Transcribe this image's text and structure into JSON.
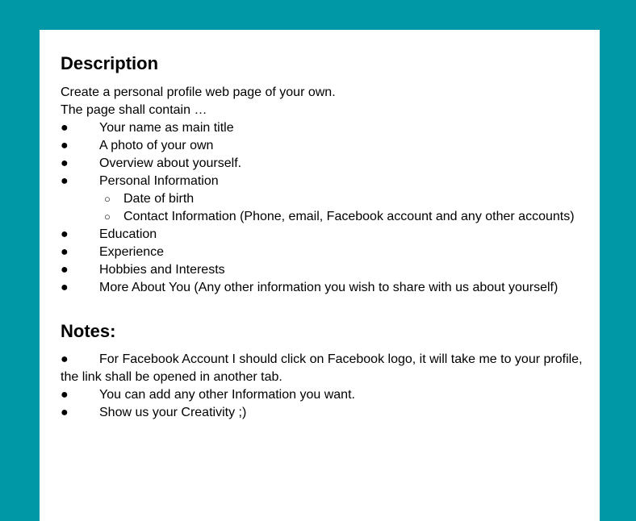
{
  "description": {
    "title": "Description",
    "intro1": "Create a personal profile web page of your own.",
    "intro2": "The page shall contain …",
    "bullet_glyph": "●",
    "sub_bullet_glyph": "○",
    "items": [
      "Your name as main title",
      "A photo of your own",
      "Overview about yourself.",
      "Personal Information"
    ],
    "sub_items": [
      "Date of birth",
      "Contact Information (Phone, email, Facebook account and any other accounts)"
    ],
    "items_after": [
      "Education",
      "Experience",
      "Hobbies and Interests",
      "More About You (Any other  information you wish to share with us about yourself)"
    ]
  },
  "notes": {
    "title": "Notes:",
    "note1_line1": "For Facebook Account I should click on Facebook logo, it will take me to your profile,",
    "note1_line2": "the link shall be opened in another tab.",
    "note2": "You can add any other Information you want.",
    "note3": "Show us your Creativity ;)"
  }
}
